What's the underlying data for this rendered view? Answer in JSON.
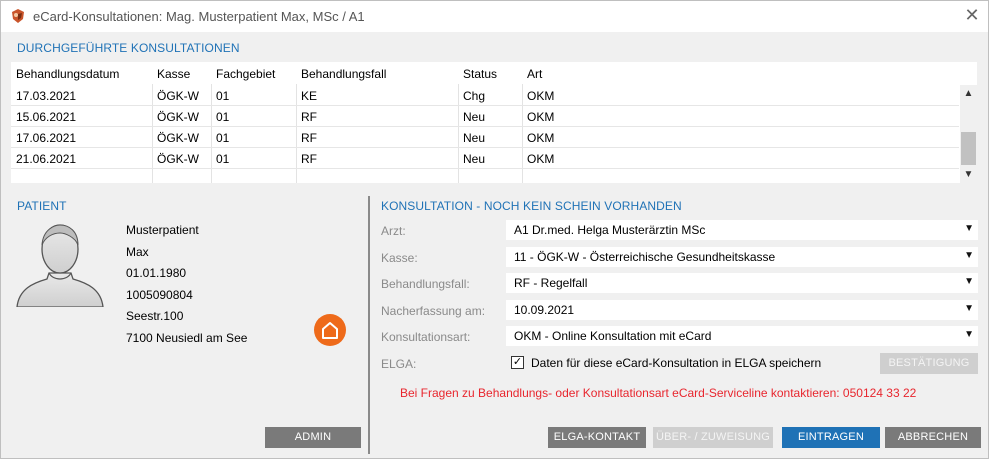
{
  "window": {
    "title": "eCard-Konsultationen: Mag. Musterpatient Max, MSc / A1",
    "close_icon": "close-icon"
  },
  "history": {
    "section_title": "DURCHGEFÜHRTE KONSULTATIONEN",
    "columns": [
      "Behandlungsdatum",
      "Kasse",
      "Fachgebiet",
      "Behandlungsfall",
      "Status",
      "Art"
    ],
    "rows": [
      [
        "17.03.2021",
        "ÖGK-W",
        "01",
        "KE",
        "Chg",
        "OKM"
      ],
      [
        "15.06.2021",
        "ÖGK-W",
        "01",
        "RF",
        "Neu",
        "OKM"
      ],
      [
        "17.06.2021",
        "ÖGK-W",
        "01",
        "RF",
        "Neu",
        "OKM"
      ],
      [
        "21.06.2021",
        "ÖGK-W",
        "01",
        "RF",
        "Neu",
        "OKM"
      ]
    ]
  },
  "patient": {
    "section_title": "PATIENT",
    "lastname": "Musterpatient",
    "firstname": "Max",
    "birthdate": "01.01.1980",
    "ssn": "1005090804",
    "street": "Seestr.100",
    "city": "7100 Neusiedl am See",
    "admin_label": "ADMIN"
  },
  "consultation": {
    "section_title": "KONSULTATION - NOCH KEIN SCHEIN VORHANDEN",
    "arzt_label": "Arzt:",
    "arzt_value": "A1   Dr.med. Helga Musterärztin MSc",
    "kasse_label": "Kasse:",
    "kasse_value": "11 - ÖGK-W - Österreichische Gesundheitskasse",
    "fall_label": "Behandlungsfall:",
    "fall_value": "RF - Regelfall",
    "nach_label": "Nacherfassung am:",
    "nach_value": "10.09.2021",
    "art_label": "Konsultationsart:",
    "art_value": "OKM - Online Konsultation mit eCard",
    "elga_label": "ELGA:",
    "elga_checkbox": "Daten für diese eCard-Konsultation in ELGA speichern",
    "elga_checked": true,
    "bestaetigung_label": "BESTÄTIGUNG",
    "info_text": "Bei Fragen zu Behandlungs- oder Konsultationsart eCard-Serviceline kontaktieren: 050124 33 22"
  },
  "buttons": {
    "elga_kontakt": "ELGA-KONTAKT",
    "ueberweisung": "ÜBER- / ZUWEISUNG",
    "eintragen": "EINTRAGEN",
    "abbrechen": "ABBRECHEN"
  },
  "colors": {
    "accent": "#1f72b6",
    "warning": "#e8262e",
    "home": "#ee6a1a"
  }
}
